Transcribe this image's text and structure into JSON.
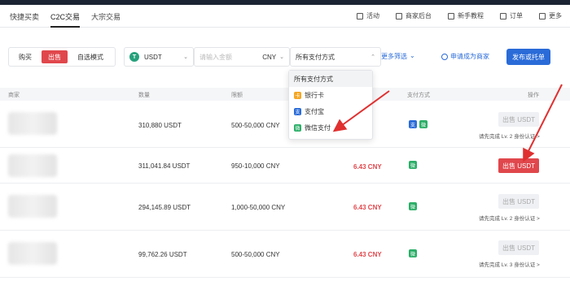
{
  "nav": {
    "tabs": [
      "快捷买卖",
      "C2C交易",
      "大宗交易"
    ],
    "links": [
      {
        "icon": "grid-icon",
        "label": "活动"
      },
      {
        "icon": "monitor-icon",
        "label": "商家后台"
      },
      {
        "icon": "book-icon",
        "label": "新手教程"
      },
      {
        "icon": "order-icon",
        "label": "订单"
      },
      {
        "icon": "more-icon",
        "label": "更多"
      }
    ]
  },
  "filters": {
    "buy_label": "购买",
    "sell_label": "出售",
    "self_select_label": "自选模式",
    "coin_value": "USDT",
    "coin_icon_glyph": "T",
    "amount_placeholder": "请输入金额",
    "currency_value": "CNY",
    "payment_value": "所有支付方式",
    "more_filters_label": "更多筛选",
    "merchant_label": "申请成为商家",
    "publish_label": "发布或托单"
  },
  "table": {
    "headers": {
      "merchant": "商家",
      "quantity": "数量",
      "limit": "限额",
      "payment": "支付方式",
      "action": "操作"
    },
    "rows": [
      {
        "quantity": "310,880 USDT",
        "limit": "500-50,000 CNY",
        "price": "",
        "pay_icons": [
          "ali",
          "wx"
        ],
        "button": "出售 USDT",
        "enabled": false,
        "note": "请先完成 Lv. 2 身份认证 >"
      },
      {
        "quantity": "311,041.84 USDT",
        "limit": "950-10,000 CNY",
        "price": "6.43 CNY",
        "pay_icons": [
          "wx"
        ],
        "button": "出售 USDT",
        "enabled": true,
        "note": ""
      },
      {
        "quantity": "294,145.89 USDT",
        "limit": "1,000-50,000 CNY",
        "price": "6.43 CNY",
        "pay_icons": [
          "wx"
        ],
        "button": "出售 USDT",
        "enabled": false,
        "note": "请先完成 Lv. 2 身份认证 >"
      },
      {
        "quantity": "99,762.26 USDT",
        "limit": "500-50,000 CNY",
        "price": "6.43 CNY",
        "pay_icons": [
          "wx"
        ],
        "button": "出售 USDT",
        "enabled": false,
        "note": "请先完成 Lv. 3 身份认证 >"
      }
    ]
  },
  "dropdown": {
    "items": [
      {
        "icon": "",
        "label": "所有支付方式"
      },
      {
        "icon": "bank",
        "label": "银行卡"
      },
      {
        "icon": "ali",
        "label": "支付宝"
      },
      {
        "icon": "wx",
        "label": "微信支付"
      }
    ]
  },
  "colors": {
    "accent_red": "#e0474c",
    "accent_blue": "#2a6bd8",
    "wechat_green": "#2aae67",
    "annotation_arrow": "#e03030"
  }
}
